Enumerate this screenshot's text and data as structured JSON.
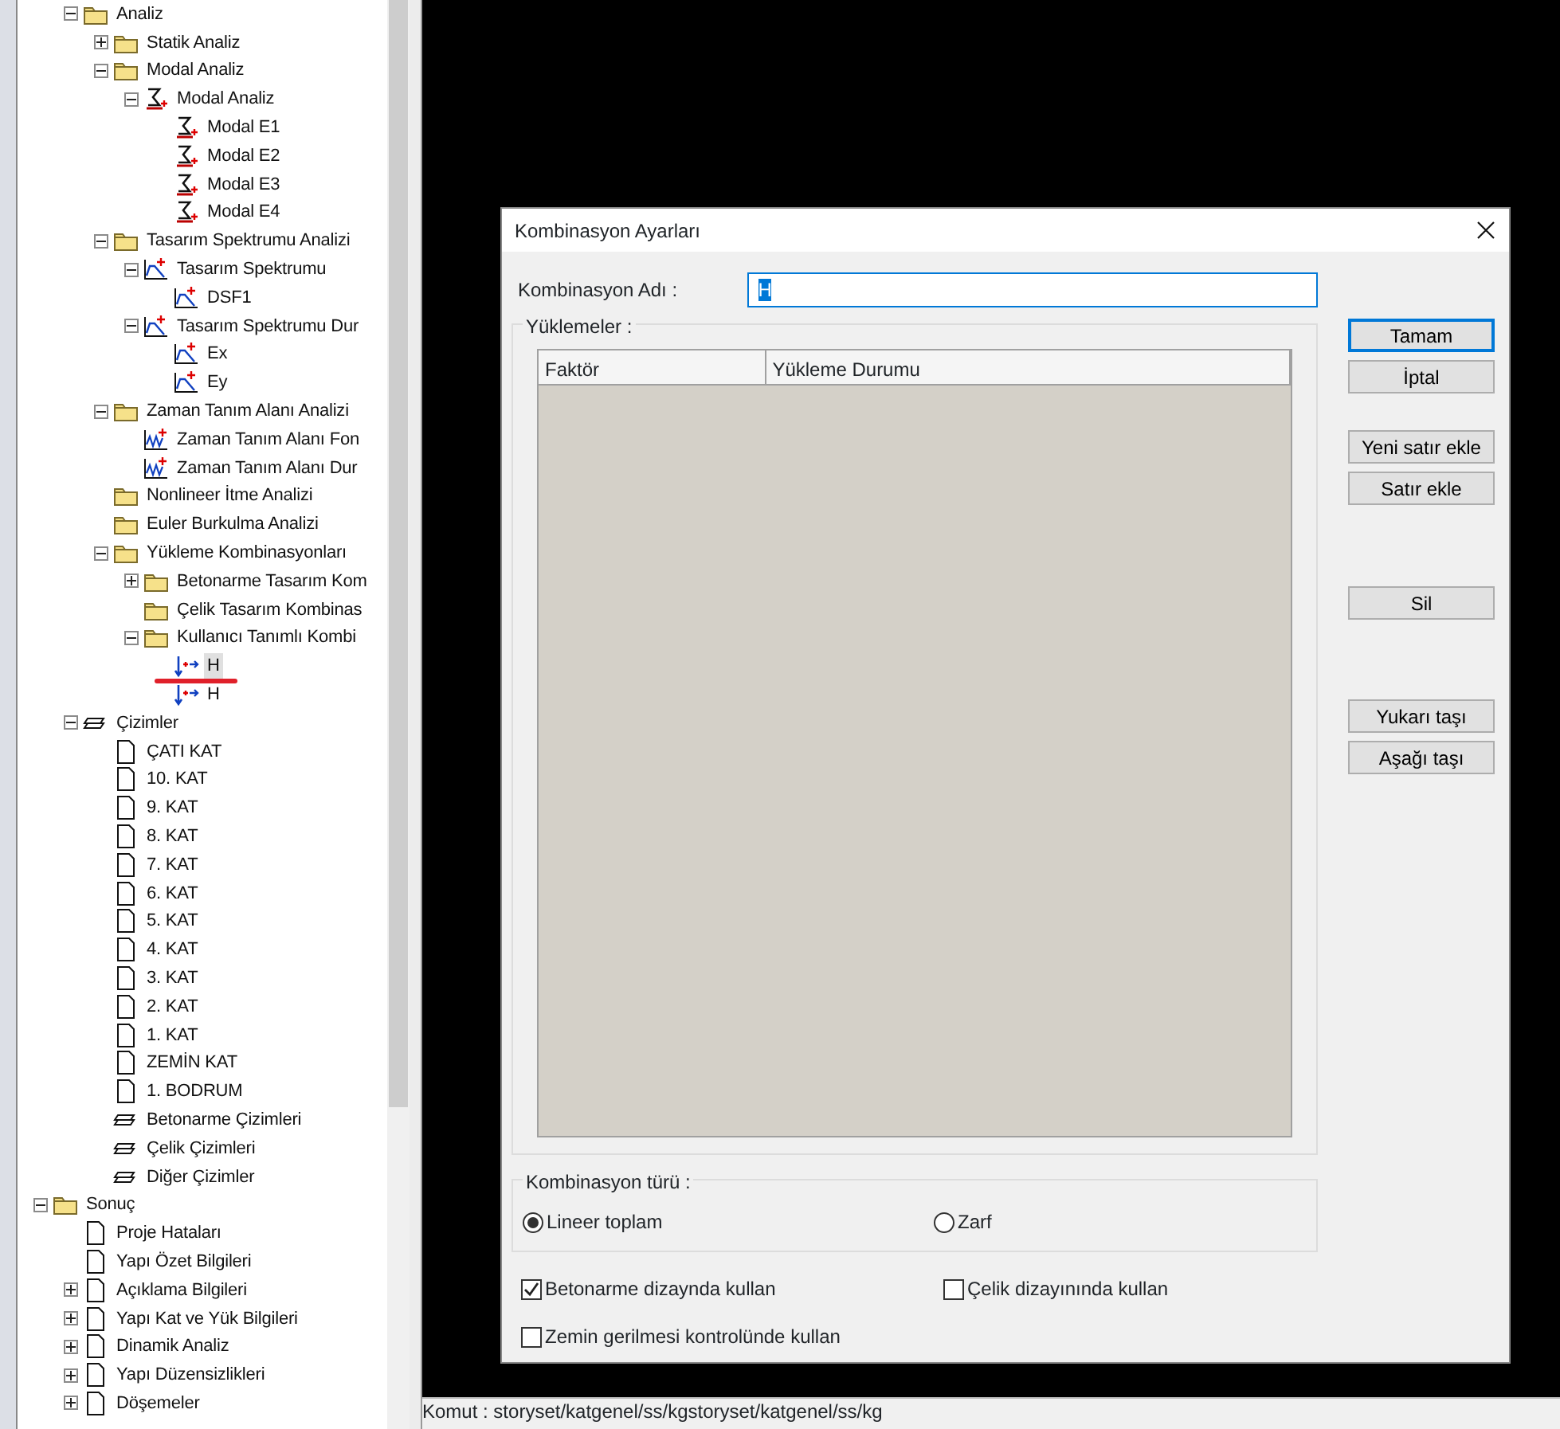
{
  "tree": [
    {
      "children": [
        {
          "label": "Analiz",
          "kind": "folder",
          "expanded": true,
          "children": [
            {
              "label": "Statik Analiz",
              "kind": "folder",
              "expanded": false
            },
            {
              "label": "Modal Analiz",
              "kind": "folder",
              "expanded": true,
              "children": [
                {
                  "label": "Modal Analiz",
                  "kind": "sigma",
                  "expanded": true,
                  "children": [
                    {
                      "label": "Modal E1",
                      "kind": "sigma"
                    },
                    {
                      "label": "Modal E2",
                      "kind": "sigma"
                    },
                    {
                      "label": "Modal E3",
                      "kind": "sigma"
                    },
                    {
                      "label": "Modal E4",
                      "kind": "sigma"
                    }
                  ]
                }
              ]
            },
            {
              "label": "Tasarım Spektrumu Analizi",
              "kind": "folder",
              "expanded": true,
              "children": [
                {
                  "label": "Tasarım Spektrumu",
                  "kind": "spectrum",
                  "expanded": true,
                  "children": [
                    {
                      "label": "DSF1",
                      "kind": "spectrum"
                    }
                  ]
                },
                {
                  "label": "Tasarım Spektrumu Dur",
                  "kind": "spectrum",
                  "expanded": true,
                  "children": [
                    {
                      "label": "Ex",
                      "kind": "spectrum"
                    },
                    {
                      "label": "Ey",
                      "kind": "spectrum"
                    }
                  ]
                }
              ]
            },
            {
              "label": "Zaman Tanım Alanı Analizi",
              "kind": "folder",
              "expanded": true,
              "children": [
                {
                  "label": "Zaman Tanım Alanı Fon",
                  "kind": "wave"
                },
                {
                  "label": "Zaman Tanım Alanı Dur",
                  "kind": "wave"
                }
              ]
            },
            {
              "label": "Nonlineer İtme Analizi",
              "kind": "folder"
            },
            {
              "label": "Euler Burkulma Analizi",
              "kind": "folder"
            },
            {
              "label": "Yükleme Kombinasyonları",
              "kind": "folder",
              "expanded": true,
              "children": [
                {
                  "label": "Betonarme Tasarım Kom",
                  "kind": "folder",
                  "expanded": false
                },
                {
                  "label": "Çelik Tasarım Kombinas",
                  "kind": "folder"
                },
                {
                  "label": "Kullanıcı Tanımlı Kombi",
                  "kind": "folder",
                  "expanded": true,
                  "children": [
                    {
                      "label": "H",
                      "kind": "load",
                      "selected": true,
                      "underlined": true
                    },
                    {
                      "label": "H",
                      "kind": "load",
                      "selected": false
                    }
                  ]
                }
              ]
            }
          ]
        },
        {
          "label": "Çizimler",
          "kind": "layers",
          "expanded": true,
          "children": [
            {
              "label": "ÇATI  KAT",
              "kind": "page"
            },
            {
              "label": "10. KAT",
              "kind": "page"
            },
            {
              "label": "9. KAT",
              "kind": "page"
            },
            {
              "label": "8. KAT",
              "kind": "page"
            },
            {
              "label": "7. KAT",
              "kind": "page"
            },
            {
              "label": "6. KAT",
              "kind": "page"
            },
            {
              "label": "5. KAT",
              "kind": "page"
            },
            {
              "label": "4. KAT",
              "kind": "page"
            },
            {
              "label": "3. KAT",
              "kind": "page"
            },
            {
              "label": "2. KAT",
              "kind": "page"
            },
            {
              "label": "1. KAT",
              "kind": "page"
            },
            {
              "label": "ZEMİN KAT",
              "kind": "page"
            },
            {
              "label": "1. BODRUM",
              "kind": "page"
            },
            {
              "label": "Betonarme Çizimleri",
              "kind": "layers"
            },
            {
              "label": "Çelik Çizimleri",
              "kind": "layers"
            },
            {
              "label": "Diğer Çizimler",
              "kind": "layers"
            }
          ]
        }
      ]
    },
    {
      "label": "Sonuç",
      "kind": "folder",
      "expanded": true,
      "children": [
        {
          "label": "Proje Hataları",
          "kind": "page"
        },
        {
          "label": "Yapı Özet Bilgileri",
          "kind": "page"
        },
        {
          "label": "Açıklama Bilgileri",
          "kind": "page",
          "expanded": false
        },
        {
          "label": "Yapı Kat ve Yük Bilgileri",
          "kind": "page",
          "expanded": false
        },
        {
          "label": "Dinamik Analiz",
          "kind": "page",
          "expanded": false
        },
        {
          "label": "Yapı Düzensizlikleri",
          "kind": "page",
          "expanded": false
        },
        {
          "label": "Döşemeler",
          "kind": "page",
          "expanded": false
        }
      ]
    }
  ],
  "dialog": {
    "title": "Kombinasyon Ayarları",
    "name_label": "Kombinasyon Adı :",
    "name_value": "H",
    "loads_group": "Yüklemeler :",
    "table": {
      "columns": [
        "Faktör",
        "Yükleme Durumu"
      ]
    },
    "buttons": [
      {
        "label": "Tamam",
        "default": true
      },
      {
        "label": "İptal",
        "default": false
      },
      {
        "label": "Yeni satır ekle",
        "default": false
      },
      {
        "label": "Satır ekle",
        "default": false
      },
      {
        "label": "Sil",
        "default": false
      },
      {
        "label": "Yukarı taşı",
        "default": false
      },
      {
        "label": "Aşağı taşı",
        "default": false
      }
    ],
    "type_group": "Kombinasyon türü :",
    "type_options": [
      {
        "label": "Lineer toplam",
        "selected": true
      },
      {
        "label": "Zarf",
        "selected": false
      }
    ],
    "options": [
      {
        "label": "Betonarme dizaynda kullan",
        "checked": true
      },
      {
        "label": "Çelik dizayınında kullan",
        "checked": false
      },
      {
        "label": "Zemin gerilmesi kontrolünde kullan",
        "checked": false
      }
    ]
  },
  "status_bar": {
    "command": "Komut : storyset/katgenel/ss/kgstoryset/katgenel/ss/kg"
  }
}
